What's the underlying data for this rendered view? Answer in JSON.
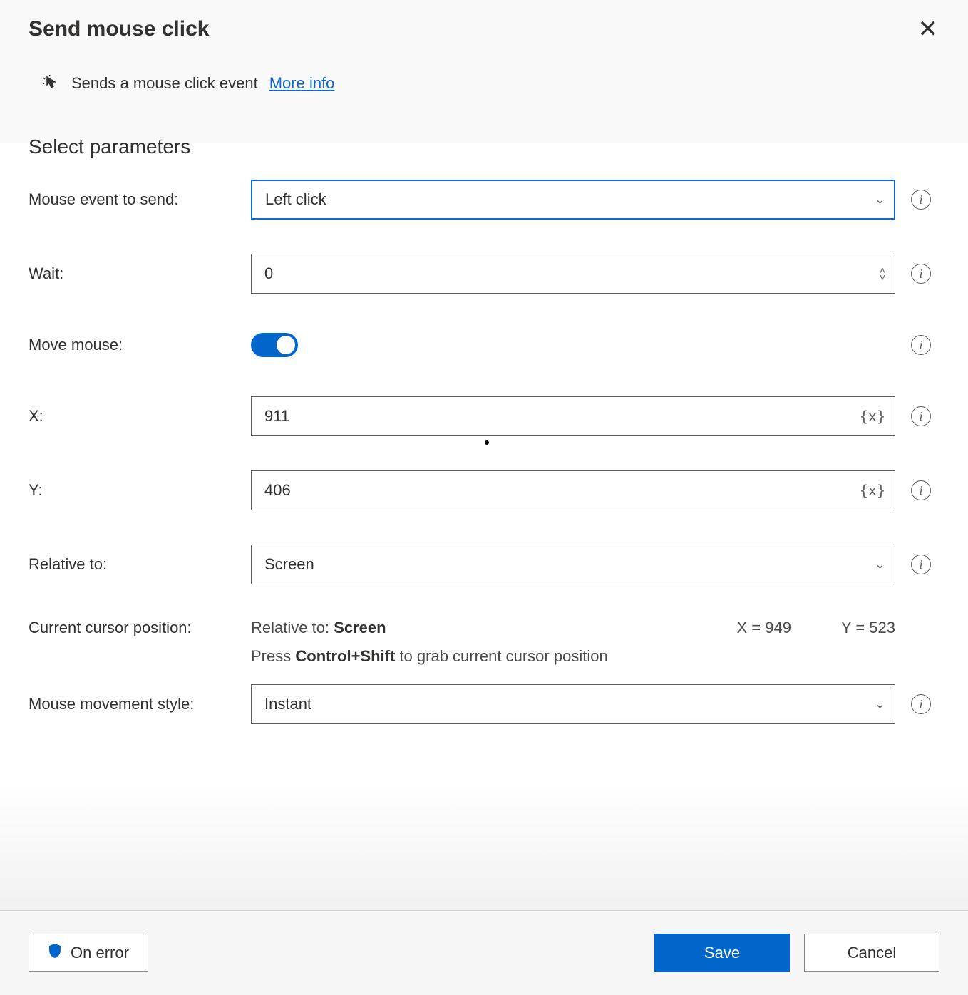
{
  "dialog": {
    "title": "Send mouse click",
    "description": "Sends a mouse click event",
    "more_info": "More info"
  },
  "section": {
    "title": "Select parameters"
  },
  "fields": {
    "mouse_event": {
      "label": "Mouse event to send:",
      "value": "Left click"
    },
    "wait": {
      "label": "Wait:",
      "value": "0"
    },
    "move_mouse": {
      "label": "Move mouse:",
      "value": true
    },
    "x": {
      "label": "X:",
      "value": "911"
    },
    "y": {
      "label": "Y:",
      "value": "406"
    },
    "relative_to": {
      "label": "Relative to:",
      "value": "Screen"
    },
    "movement": {
      "label": "Mouse movement style:",
      "value": "Instant"
    }
  },
  "cursor": {
    "label": "Current cursor position:",
    "relative_prefix": "Relative to:",
    "relative_value": "Screen",
    "x_label": "X = 949",
    "y_label": "Y = 523",
    "hint_prefix": "Press",
    "hint_keys": "Control+Shift",
    "hint_suffix": "to grab current cursor position"
  },
  "footer": {
    "on_error": "On error",
    "save": "Save",
    "cancel": "Cancel"
  }
}
